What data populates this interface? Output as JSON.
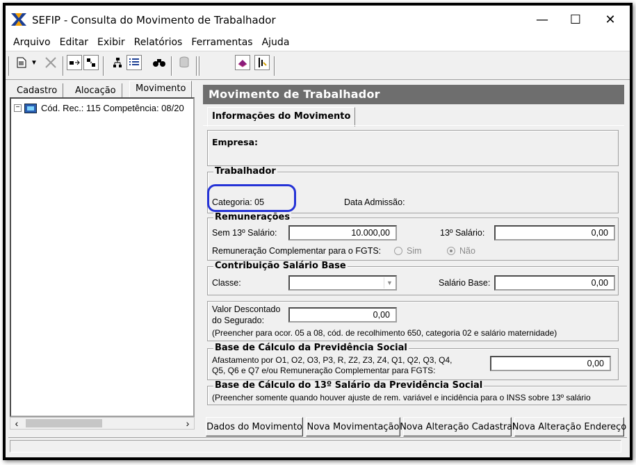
{
  "window": {
    "title": "SEFIP - Consulta do Movimento de Trabalhador",
    "minimize": "—",
    "maximize": "☐",
    "close": "✕"
  },
  "menu": [
    "Arquivo",
    "Editar",
    "Exibir",
    "Relatórios",
    "Ferramentas",
    "Ajuda"
  ],
  "left_tabs": [
    "Cadastro",
    "Alocação",
    "Movimento"
  ],
  "tree": {
    "expand": "−",
    "node_label": "Cód. Rec.: 115 Competência: 08/20"
  },
  "panel": {
    "title": "Movimento de Trabalhador",
    "tab": "Informações do Movimento",
    "empresa_label": "Empresa:",
    "trabalhador": {
      "title": "Trabalhador",
      "categoria": "Categoria: 05",
      "data_admissao": "Data Admissão:"
    },
    "remuneracoes": {
      "title": "Remunerações",
      "sem13_label": "Sem 13º Salário:",
      "sem13_value": "10.000,00",
      "s13_label": "13º Salário:",
      "s13_value": "0,00",
      "complementar_label": "Remuneração Complementar para o FGTS:",
      "sim": "Sim",
      "nao": "Não"
    },
    "contribuicao": {
      "title": "Contribuição Salário Base",
      "classe_label": "Classe:",
      "salario_base_label": "Salário Base:",
      "salario_base_value": "0,00"
    },
    "valor_descontado": {
      "label1": "Valor Descontado",
      "label2": "do Segurado:",
      "value": "0,00",
      "note": "(Preencher para ocor. 05 a 08, cód. de recolhimento 650, categoria 02 e salário maternidade)"
    },
    "base_previdencia": {
      "title": "Base de Cálculo da Previdência Social",
      "line1": "Afastamento por O1, O2, O3, P3, R, Z2, Z3, Z4, Q1, Q2, Q3, Q4,",
      "line2": "Q5, Q6 e Q7  e/ou Remuneração Complementar para FGTS:",
      "value": "0,00"
    },
    "base_13": {
      "title": "Base de Cálculo do 13º Salário da Previdência Social",
      "note": "(Preencher somente quando houver ajuste de rem. variável e incidência para o INSS sobre 13º salário"
    },
    "buttons": [
      "Dados do Movimento",
      "Nova Movimentação",
      "Nova Alteração Cadastral",
      "Nova Alteração Endereço"
    ]
  },
  "colors": {
    "header_bg": "#6e6e6e",
    "highlight": "#2432d6",
    "window_bg": "#f0f0f0"
  }
}
